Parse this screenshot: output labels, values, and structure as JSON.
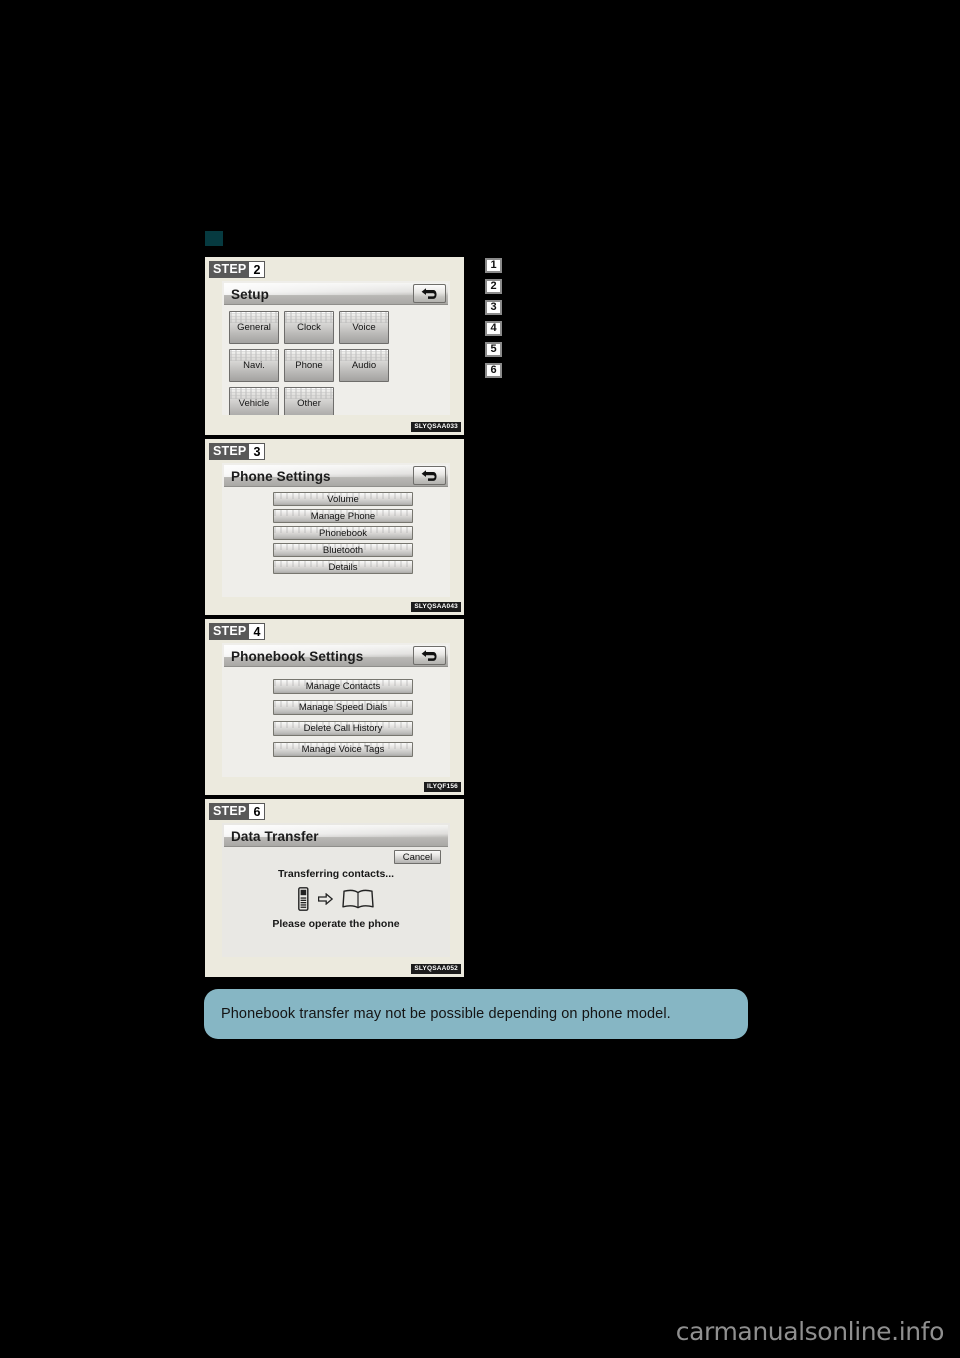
{
  "page": {
    "background_color": "#000000",
    "section_marker_color": "#063a40",
    "watermark": "carmanualsonline.info"
  },
  "callouts": [
    {
      "label": "1"
    },
    {
      "label": "2"
    },
    {
      "label": "3"
    },
    {
      "label": "4"
    },
    {
      "label": "5"
    },
    {
      "label": "6"
    }
  ],
  "panels": [
    {
      "step_word": "STEP",
      "step_number": "2",
      "screen_title": "Setup",
      "back_icon": "back-arrow-icon",
      "layout": "grid",
      "buttons": [
        {
          "label": "General"
        },
        {
          "label": "Clock"
        },
        {
          "label": "Voice"
        },
        {
          "label": "Navi."
        },
        {
          "label": "Phone"
        },
        {
          "label": "Audio"
        },
        {
          "label": "Vehicle"
        },
        {
          "label": "Other"
        }
      ],
      "image_code": "SLYQSAA033"
    },
    {
      "step_word": "STEP",
      "step_number": "3",
      "screen_title": "Phone Settings",
      "back_icon": "back-arrow-icon",
      "layout": "list",
      "buttons": [
        {
          "label": "Volume"
        },
        {
          "label": "Manage Phone"
        },
        {
          "label": "Phonebook"
        },
        {
          "label": "Bluetooth"
        },
        {
          "label": "Details"
        }
      ],
      "image_code": "SLYQSAA043"
    },
    {
      "step_word": "STEP",
      "step_number": "4",
      "screen_title": "Phonebook Settings",
      "back_icon": "back-arrow-icon",
      "layout": "list",
      "buttons": [
        {
          "label": "Manage Contacts"
        },
        {
          "label": "Manage Speed Dials"
        },
        {
          "label": "Delete Call History"
        },
        {
          "label": "Manage Voice Tags"
        }
      ],
      "image_code": "ILYQF156"
    },
    {
      "step_word": "STEP",
      "step_number": "6",
      "screen_title": "Data Transfer",
      "layout": "transfer",
      "cancel_label": "Cancel",
      "status_message": "Transferring contacts...",
      "instruction_message": "Please operate the phone",
      "icons": [
        "mobile-phone-icon",
        "right-arrow-icon",
        "open-book-icon"
      ],
      "image_code": "SLYQSAA052"
    }
  ],
  "note": {
    "text": "Phonebook transfer may not be possible depending on phone model.",
    "background_color": "#86b6c4"
  }
}
